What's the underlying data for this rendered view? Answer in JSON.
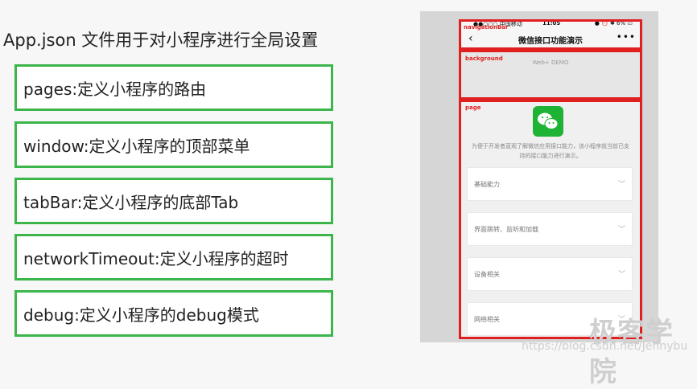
{
  "title": "App.json 文件用于对小程序进行全局设置",
  "config_items": [
    {
      "label": "pages:定义小程序的路由"
    },
    {
      "label": "window:定义小程序的顶部菜单"
    },
    {
      "label": "tabBar:定义小程序的底部Tab"
    },
    {
      "label": "networkTimeout:定义小程序的超时"
    },
    {
      "label": "debug:定义小程序的debug模式"
    }
  ],
  "phone": {
    "status": {
      "carrier": "●●○○○ 中国移动 ",
      "time": "11:05",
      "battery": "● ⏰ ✱ 6% ▭"
    },
    "navbar": {
      "back_icon": "‹",
      "title": "微信接口功能演示",
      "more_icon": "•••"
    },
    "labels": {
      "navigation_bar": "navigationBar",
      "background": "background",
      "page": "page"
    },
    "background_text": "Web+ DEMO",
    "page": {
      "description": "为便于开发者直观了解微信应用接口能力，该小程序就当前已支持的接口能力进行演示。",
      "menu": [
        {
          "label": "基础能力"
        },
        {
          "label": "界面跳转、监听和加载"
        },
        {
          "label": "设备相关"
        },
        {
          "label": "网络相关"
        }
      ]
    }
  },
  "watermark": {
    "brand": "极客学院",
    "url": "https://blog.csdn.net/Jennybu"
  },
  "colors": {
    "green_border": "#3cb54a",
    "red_frame": "#e02020",
    "wechat_green": "#1fb336"
  }
}
